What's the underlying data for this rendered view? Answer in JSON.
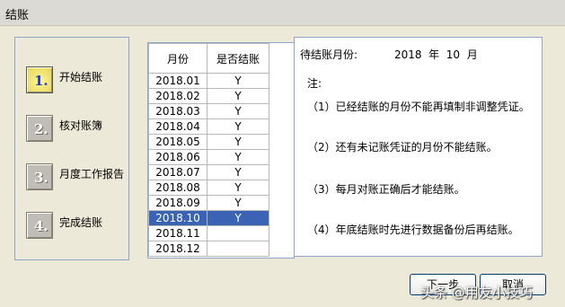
{
  "window": {
    "title": "结账"
  },
  "steps": [
    {
      "num": "1.",
      "label": "开始结账",
      "active": true
    },
    {
      "num": "2.",
      "label": "核对账簿",
      "active": false
    },
    {
      "num": "3.",
      "label": "月度工作报告",
      "active": false
    },
    {
      "num": "4.",
      "label": "完成结账",
      "active": false
    }
  ],
  "table": {
    "headers": [
      "月份",
      "是否结账"
    ],
    "rows": [
      [
        "2018.01",
        "Y"
      ],
      [
        "2018.02",
        "Y"
      ],
      [
        "2018.03",
        "Y"
      ],
      [
        "2018.04",
        "Y"
      ],
      [
        "2018.05",
        "Y"
      ],
      [
        "2018.06",
        "Y"
      ],
      [
        "2018.07",
        "Y"
      ],
      [
        "2018.08",
        "Y"
      ],
      [
        "2018.09",
        "Y"
      ],
      [
        "2018.10",
        "Y"
      ],
      [
        "2018.11",
        ""
      ],
      [
        "2018.12",
        ""
      ]
    ],
    "selected_row": "2018.10"
  },
  "notes": {
    "period_label": "待结账月份:",
    "period_value": "2018  年  10  月",
    "heading": "注:",
    "items": [
      "（1）已经结账的月份不能再填制非调整凭证。",
      "（2）还有未记账凭证的月份不能结账。",
      "（3）每月对账正确后才能结账。",
      "（4）年底结账时先进行数据备份后再结账。"
    ]
  },
  "buttons": {
    "next": "下一步",
    "cancel": "取消"
  },
  "watermark": "头条 @用友小技巧"
}
